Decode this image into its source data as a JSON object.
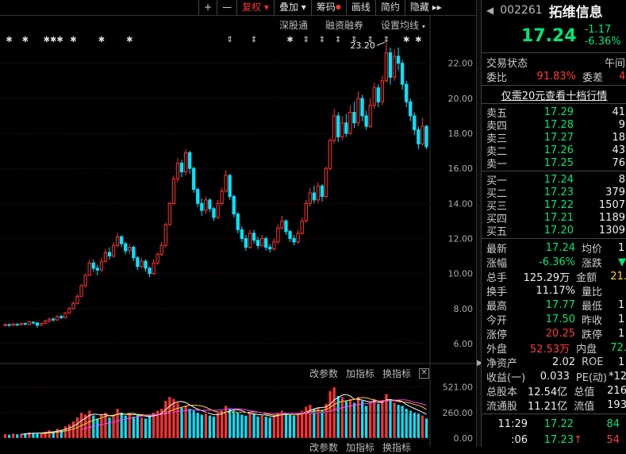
{
  "toolbar": {
    "plus": "+",
    "minus": "—",
    "fuquan": "复权",
    "fuquan_caret": "▾",
    "diejia": "叠加",
    "diejia_caret": "▾",
    "chouma": "筹码",
    "huaxian": "画线",
    "jianyue": "简约",
    "yincang": "隐藏",
    "more": "▸▸"
  },
  "subtoolbar": {
    "shengutong": "深股通",
    "rongzi": "融资融券",
    "settings": "设置均线",
    "settings_caret": "▾"
  },
  "marker_glyphs": [
    "✱",
    "✱",
    "✱✱✱",
    "✱",
    "✱",
    "✱",
    "⇕",
    "⇕",
    "✱",
    "⇕",
    "⇕",
    "⇕",
    "⇕",
    "⇕",
    "⇕",
    "✱",
    "✱"
  ],
  "price_axis": {
    "ticks": [
      "22.00",
      "20.00",
      "18.00",
      "16.00",
      "14.00",
      "12.00",
      "10.00",
      "8.00",
      "6.00"
    ]
  },
  "high_label": "23.20",
  "volume_axis": {
    "ticks": [
      "521.00",
      "260.00",
      "0.00"
    ]
  },
  "volume_toolbar": {
    "gaicanshu": "改参数",
    "zengzhibiao": "加指标",
    "huanzhibiao": "换指标",
    "close": "✕"
  },
  "volume_toolbar_bottom": {
    "gaicanshu": "改参数",
    "zengzhibiao": "加指标",
    "huanzhibiao": "换指标"
  },
  "colors": {
    "up": "#ff3232",
    "down": "#00e5ff",
    "ma5": "#ffffff",
    "ma10": "#ffd23c",
    "ma20": "#ff44ff"
  },
  "stock": {
    "code": "002261",
    "name": "拓维信息",
    "price": "17.24",
    "change": "-1.17",
    "change_pct": "-6.36%",
    "back_icon": "◀"
  },
  "status": {
    "label": "交易状态",
    "value": "午间"
  },
  "weibi": {
    "label": "委比",
    "value": "91.83%",
    "wc_label": "委差",
    "wc_value": "4"
  },
  "promo": "仅需20元查看十档行情",
  "asks": [
    {
      "label": "卖五",
      "price": "17.29",
      "vol": "41"
    },
    {
      "label": "卖四",
      "price": "17.28",
      "vol": "9"
    },
    {
      "label": "卖三",
      "price": "17.27",
      "vol": "18"
    },
    {
      "label": "卖二",
      "price": "17.26",
      "vol": "43"
    },
    {
      "label": "卖一",
      "price": "17.25",
      "vol": "76"
    }
  ],
  "bids": [
    {
      "label": "买一",
      "price": "17.24",
      "vol": "8"
    },
    {
      "label": "买二",
      "price": "17.23",
      "vol": "379"
    },
    {
      "label": "买三",
      "price": "17.22",
      "vol": "1507"
    },
    {
      "label": "买四",
      "price": "17.21",
      "vol": "1189"
    },
    {
      "label": "买五",
      "price": "17.20",
      "vol": "1309"
    }
  ],
  "stats": [
    {
      "l1": "最新",
      "v1": "17.24",
      "c1": "grn",
      "l2": "均价",
      "v2": "1"
    },
    {
      "l1": "涨幅",
      "v1": "-6.36%",
      "c1": "grn",
      "l2": "涨跌",
      "v2": "▼",
      "c2": "grn"
    },
    {
      "l1": "总手",
      "v1": "125.29万",
      "c1": "wht",
      "l2": "金额",
      "v2": "21.",
      "c2": "yel"
    },
    {
      "l1": "换手",
      "v1": "11.17%",
      "c1": "wht",
      "l2": "量比",
      "v2": ""
    },
    {
      "l1": "最高",
      "v1": "17.77",
      "c1": "grn",
      "l2": "最低",
      "v2": "1"
    },
    {
      "l1": "今开",
      "v1": "17.50",
      "c1": "grn",
      "l2": "昨收",
      "v2": "1"
    },
    {
      "l1": "涨停",
      "v1": "20.25",
      "c1": "red",
      "l2": "跌停",
      "v2": "1"
    },
    {
      "l1": "外盘",
      "v1": "52.53万",
      "c1": "red",
      "l2": "内盘",
      "v2": "72.",
      "c2": "grn"
    },
    {
      "l1": "净资产",
      "v1": "2.02",
      "c1": "wht",
      "l2": "ROE",
      "v2": "1"
    },
    {
      "l1": "收益(一)",
      "v1": "0.033",
      "c1": "wht",
      "l2": "PE(动)",
      "v2": "*12"
    },
    {
      "l1": "总股本",
      "v1": "12.54亿",
      "c1": "wht",
      "l2": "总值",
      "v2": "216"
    },
    {
      "l1": "流通股",
      "v1": "11.21亿",
      "c1": "wht",
      "l2": "流值",
      "v2": "193"
    }
  ],
  "ticks_list": [
    {
      "time": "11:29",
      "price": "17.22",
      "arrow": "",
      "vol": "84",
      "vcolor": "grn"
    },
    {
      "time": ":06",
      "price": "17.23",
      "arrow": "↑",
      "vol": "54",
      "vcolor": "red"
    }
  ],
  "chart_data": {
    "type": "candlestick",
    "price_ylim": [
      5.0,
      23.8
    ],
    "volume_ylim": [
      0,
      600
    ],
    "high_annotation": 23.2,
    "candles": [
      [
        7.05,
        7.1,
        6.95,
        7.12
      ],
      [
        7.08,
        7.05,
        6.98,
        7.15
      ],
      [
        7.05,
        7.12,
        7.0,
        7.18
      ],
      [
        7.1,
        7.08,
        7.02,
        7.16
      ],
      [
        7.08,
        7.15,
        7.02,
        7.2
      ],
      [
        7.14,
        7.1,
        7.05,
        7.22
      ],
      [
        7.1,
        7.25,
        7.05,
        7.3
      ],
      [
        7.22,
        7.18,
        7.1,
        7.28
      ],
      [
        7.18,
        7.05,
        6.9,
        7.22
      ],
      [
        7.05,
        7.15,
        7.0,
        7.2
      ],
      [
        7.15,
        7.3,
        7.1,
        7.35
      ],
      [
        7.28,
        7.4,
        7.2,
        7.48
      ],
      [
        7.4,
        7.35,
        7.25,
        7.5
      ],
      [
        7.35,
        7.55,
        7.3,
        7.6
      ],
      [
        7.55,
        7.48,
        7.4,
        7.65
      ],
      [
        7.48,
        7.75,
        7.45,
        7.8
      ],
      [
        7.75,
        8.0,
        7.7,
        8.1
      ],
      [
        8.0,
        8.3,
        7.95,
        8.4
      ],
      [
        8.3,
        8.7,
        8.25,
        8.8
      ],
      [
        8.7,
        9.3,
        8.65,
        9.4
      ],
      [
        9.3,
        9.9,
        9.2,
        10.0
      ],
      [
        9.9,
        10.6,
        9.85,
        10.8
      ],
      [
        10.6,
        10.3,
        10.1,
        10.8
      ],
      [
        10.3,
        10.2,
        9.9,
        10.5
      ],
      [
        10.2,
        10.7,
        10.1,
        10.9
      ],
      [
        10.7,
        11.2,
        10.6,
        11.4
      ],
      [
        11.2,
        11.0,
        10.8,
        11.5
      ],
      [
        11.0,
        11.6,
        10.9,
        11.8
      ],
      [
        11.6,
        12.1,
        11.5,
        12.3
      ],
      [
        12.1,
        11.7,
        11.5,
        12.2
      ],
      [
        11.7,
        11.3,
        11.1,
        11.8
      ],
      [
        11.3,
        11.5,
        11.1,
        11.7
      ],
      [
        11.5,
        10.9,
        10.7,
        11.6
      ],
      [
        10.9,
        10.4,
        10.2,
        11.0
      ],
      [
        10.4,
        10.7,
        10.3,
        10.9
      ],
      [
        10.7,
        10.3,
        10.1,
        10.8
      ],
      [
        10.3,
        10.0,
        9.8,
        10.4
      ],
      [
        10.0,
        10.6,
        9.9,
        10.8
      ],
      [
        10.6,
        11.1,
        10.5,
        11.2
      ],
      [
        11.1,
        11.6,
        11.0,
        11.8
      ],
      [
        11.6,
        12.8,
        11.5,
        12.9
      ],
      [
        12.8,
        14.0,
        12.7,
        14.1
      ],
      [
        14.0,
        15.4,
        13.9,
        15.6
      ],
      [
        15.4,
        16.3,
        15.2,
        16.6
      ],
      [
        16.3,
        15.8,
        15.5,
        16.5
      ],
      [
        15.8,
        16.9,
        15.6,
        17.1
      ],
      [
        16.9,
        16.0,
        15.7,
        17.0
      ],
      [
        16.0,
        14.8,
        14.6,
        16.1
      ],
      [
        14.8,
        14.0,
        13.8,
        14.9
      ],
      [
        14.0,
        13.6,
        13.3,
        14.3
      ],
      [
        13.6,
        14.2,
        13.4,
        14.4
      ],
      [
        14.2,
        13.7,
        13.5,
        14.3
      ],
      [
        13.7,
        13.2,
        13.0,
        13.8
      ],
      [
        13.2,
        14.0,
        13.1,
        14.2
      ],
      [
        14.0,
        14.7,
        13.9,
        14.9
      ],
      [
        14.7,
        15.6,
        14.6,
        15.9
      ],
      [
        15.6,
        14.4,
        14.2,
        15.7
      ],
      [
        14.4,
        13.4,
        13.2,
        14.5
      ],
      [
        13.4,
        12.5,
        12.3,
        13.5
      ],
      [
        12.5,
        12.0,
        11.8,
        12.7
      ],
      [
        12.0,
        11.5,
        11.3,
        12.2
      ],
      [
        11.5,
        12.3,
        11.4,
        12.5
      ],
      [
        12.3,
        11.9,
        11.7,
        12.5
      ],
      [
        11.9,
        11.6,
        11.4,
        12.1
      ],
      [
        11.6,
        12.0,
        11.5,
        12.2
      ],
      [
        12.0,
        11.5,
        11.3,
        12.1
      ],
      [
        11.5,
        11.4,
        11.2,
        11.7
      ],
      [
        11.4,
        11.8,
        11.3,
        12.0
      ],
      [
        11.8,
        12.6,
        11.7,
        12.8
      ],
      [
        12.6,
        13.0,
        12.5,
        13.3
      ],
      [
        13.0,
        12.4,
        12.2,
        13.1
      ],
      [
        12.4,
        12.0,
        11.8,
        12.5
      ],
      [
        12.0,
        11.8,
        11.6,
        12.2
      ],
      [
        11.8,
        12.3,
        11.7,
        12.5
      ],
      [
        12.3,
        13.0,
        12.2,
        13.2
      ],
      [
        13.0,
        14.0,
        12.9,
        14.2
      ],
      [
        14.0,
        14.6,
        13.8,
        14.9
      ],
      [
        14.6,
        14.2,
        14.0,
        15.0
      ],
      [
        14.2,
        15.0,
        14.0,
        15.2
      ],
      [
        15.0,
        14.4,
        14.1,
        15.1
      ],
      [
        14.4,
        16.0,
        14.3,
        16.1
      ],
      [
        16.0,
        17.6,
        15.9,
        17.7
      ],
      [
        17.6,
        19.0,
        17.4,
        19.4
      ],
      [
        19.0,
        17.8,
        17.5,
        19.2
      ],
      [
        17.8,
        18.6,
        17.6,
        19.0
      ],
      [
        18.6,
        18.0,
        17.8,
        19.1
      ],
      [
        18.0,
        19.2,
        17.9,
        19.6
      ],
      [
        19.2,
        18.6,
        18.3,
        19.8
      ],
      [
        18.6,
        20.0,
        18.4,
        20.4
      ],
      [
        20.0,
        19.0,
        18.7,
        20.2
      ],
      [
        19.0,
        18.4,
        18.2,
        19.3
      ],
      [
        18.4,
        19.6,
        18.3,
        20.0
      ],
      [
        19.6,
        20.6,
        19.4,
        20.9
      ],
      [
        20.6,
        19.8,
        19.5,
        20.8
      ],
      [
        19.8,
        21.0,
        19.6,
        21.3
      ],
      [
        21.0,
        22.6,
        20.9,
        23.2
      ],
      [
        22.6,
        21.2,
        20.8,
        22.9
      ],
      [
        21.2,
        22.4,
        21.0,
        22.8
      ],
      [
        22.4,
        22.0,
        21.6,
        22.9
      ],
      [
        22.0,
        20.8,
        20.5,
        22.2
      ],
      [
        20.8,
        19.8,
        19.5,
        21.0
      ],
      [
        19.8,
        19.0,
        18.7,
        20.0
      ],
      [
        19.0,
        18.2,
        17.9,
        19.2
      ],
      [
        18.2,
        17.4,
        17.1,
        18.4
      ],
      [
        17.4,
        18.4,
        17.3,
        18.9
      ],
      [
        18.4,
        17.24,
        17.1,
        18.5
      ]
    ],
    "volume": [
      40,
      35,
      45,
      38,
      42,
      50,
      60,
      55,
      48,
      52,
      65,
      80,
      70,
      95,
      85,
      120,
      140,
      170,
      210,
      260,
      240,
      280,
      230,
      200,
      240,
      260,
      210,
      220,
      300,
      260,
      230,
      250,
      220,
      240,
      210,
      200,
      230,
      260,
      280,
      300,
      380,
      420,
      400,
      360,
      310,
      330,
      300,
      280,
      260,
      240,
      250,
      230,
      220,
      260,
      280,
      330,
      300,
      280,
      260,
      240,
      230,
      260,
      250,
      220,
      230,
      220,
      210,
      230,
      260,
      280,
      260,
      240,
      230,
      250,
      280,
      320,
      340,
      300,
      310,
      290,
      350,
      480,
      521,
      430,
      420,
      380,
      400,
      360,
      420,
      380,
      330,
      360,
      400,
      350,
      390,
      450,
      380,
      360,
      340,
      330,
      300,
      280,
      260,
      250,
      230,
      200
    ]
  }
}
